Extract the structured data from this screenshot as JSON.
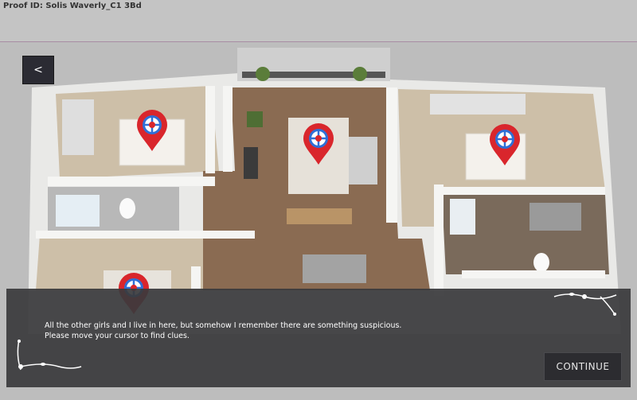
{
  "header": {
    "proof_id": "Proof ID: Solis Waverly_C1 3Bd"
  },
  "nav": {
    "back_label": "<"
  },
  "dialog": {
    "line1": "All the other girls and I live in here, but somehow I remember there are something suspicious.",
    "line2": "Please move your cursor to find clues.",
    "continue_label": "CONTINUE"
  },
  "colors": {
    "pin_red": "#d9262c",
    "pin_blue": "#2f6fd6",
    "floor": "#8a6b52",
    "wall": "#f2f2f0"
  },
  "markers": [
    {
      "name": "clue-marker-bedroom-top-left"
    },
    {
      "name": "clue-marker-living-room"
    },
    {
      "name": "clue-marker-bedroom-right"
    },
    {
      "name": "clue-marker-bedroom-bottom-left"
    }
  ]
}
